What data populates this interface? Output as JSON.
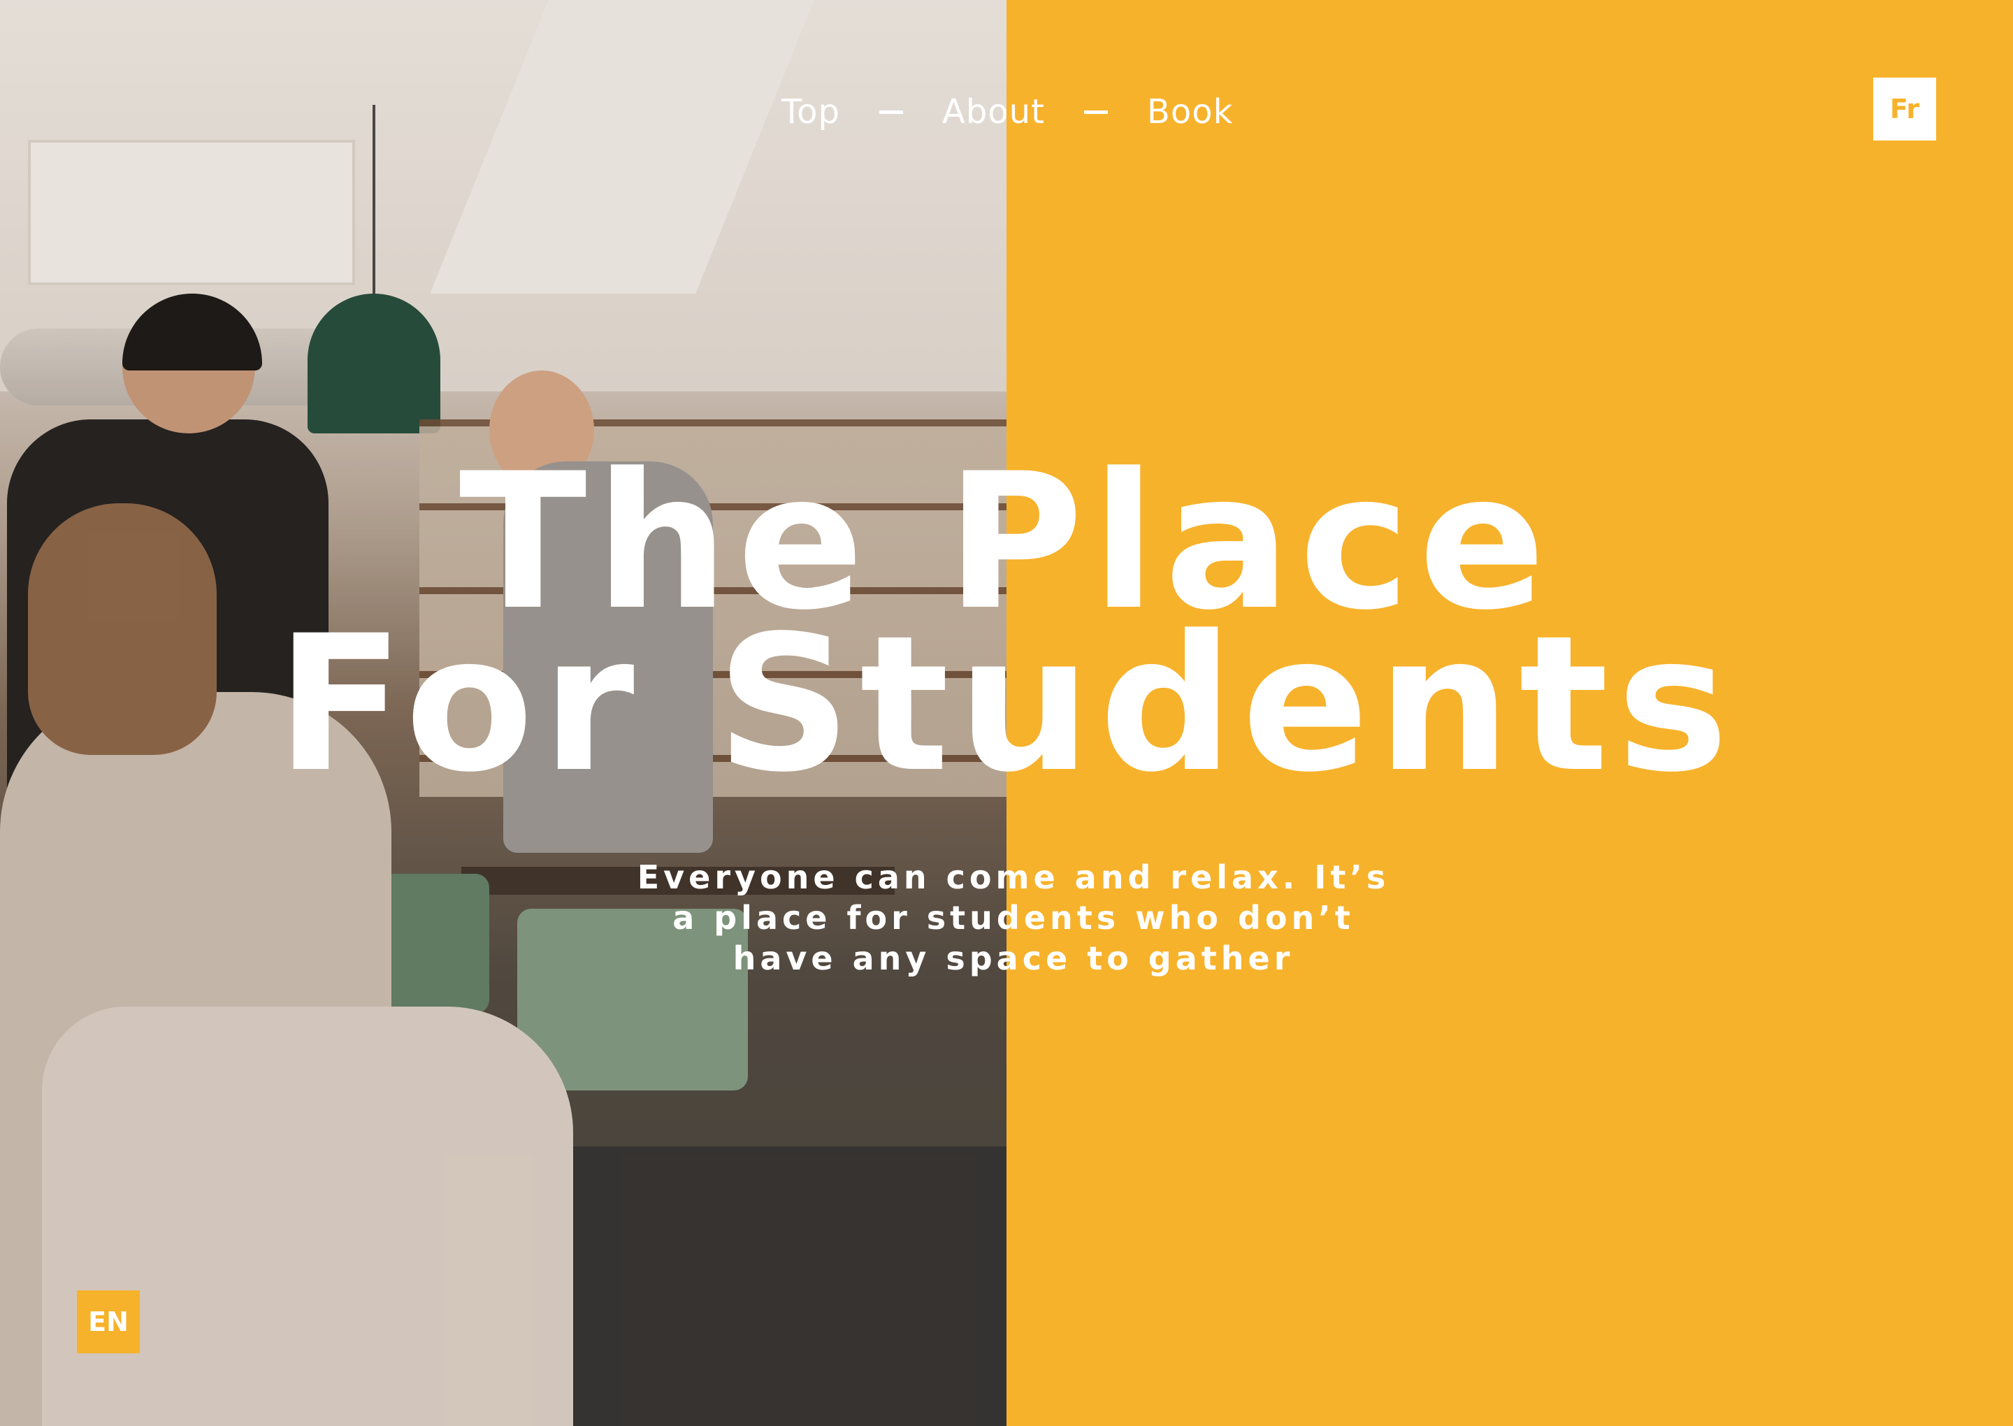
{
  "nav": {
    "items": [
      {
        "label": "Top"
      },
      {
        "label": "About"
      },
      {
        "label": "Book"
      }
    ]
  },
  "language": {
    "alternate": "Fr",
    "current": "EN"
  },
  "hero": {
    "title_line1": "The Place",
    "title_line2": "For Students",
    "subtitle": "Everyone can come and relax. It’s a place for students who don’t have any space to gather"
  },
  "colors": {
    "accent": "#f7b22b",
    "text": "#ffffff"
  }
}
